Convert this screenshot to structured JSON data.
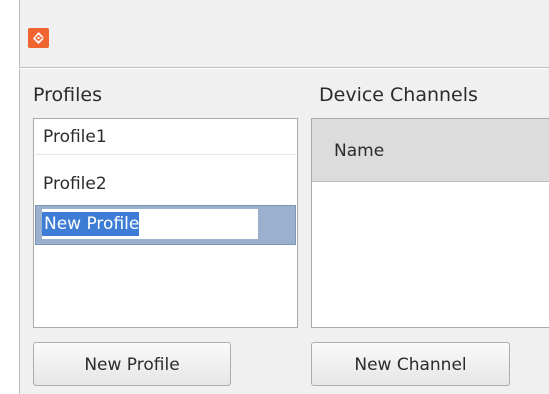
{
  "window": {
    "icon": "app-logo-icon",
    "accent_color": "#f0652f"
  },
  "profiles": {
    "label": "Profiles",
    "items": [
      {
        "label": "Profile1"
      },
      {
        "label": "Profile2"
      }
    ],
    "editing_item": {
      "value": "New Profile",
      "selected": true
    },
    "new_button_label": "New Profile"
  },
  "channels": {
    "label": "Device Channels",
    "columns": [
      {
        "header": "Name"
      }
    ],
    "rows": [],
    "new_button_label": "New Channel"
  }
}
